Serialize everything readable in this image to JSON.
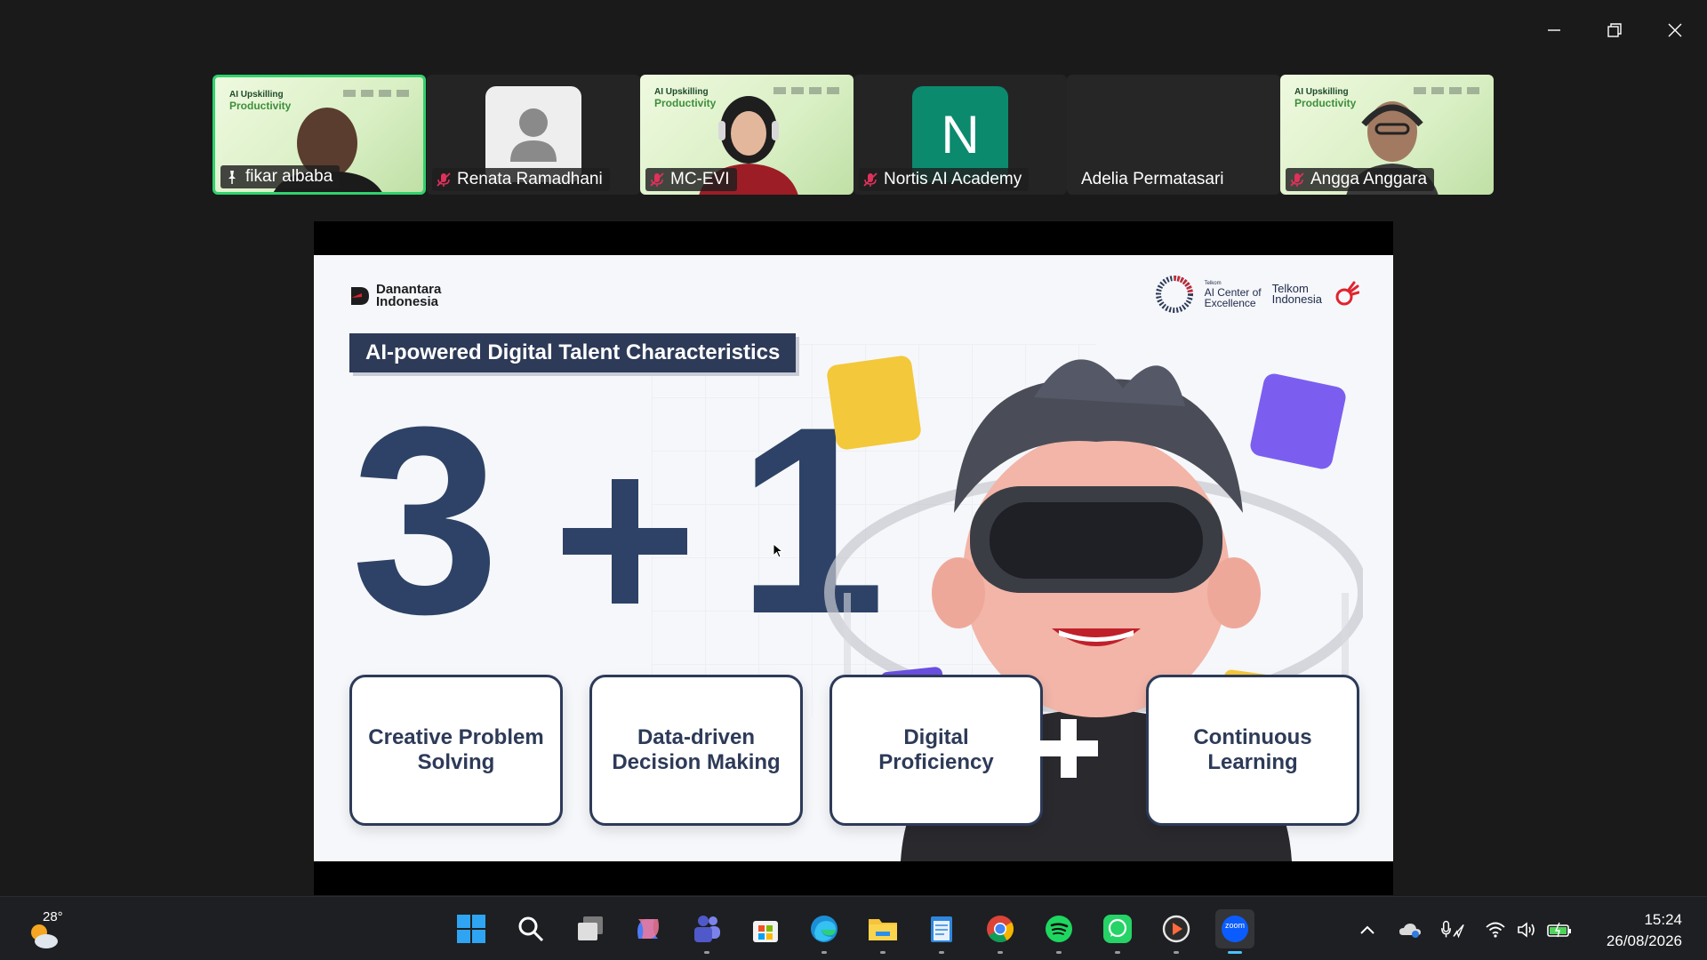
{
  "window": {
    "controls": [
      "minimize",
      "restore",
      "close"
    ]
  },
  "participants": [
    {
      "name": "fikar albaba",
      "muted": false,
      "pinned": true,
      "speaking": true,
      "type": "video"
    },
    {
      "name": "Renata Ramadhani",
      "muted": true,
      "type": "avatar-default"
    },
    {
      "name": "MC-EVI",
      "muted": true,
      "type": "video"
    },
    {
      "name": "Nortis AI Academy",
      "muted": true,
      "type": "avatar-letter",
      "initial": "N",
      "avatar_color": "#0b8a6e"
    },
    {
      "name": "Adelia Permatasari",
      "muted": false,
      "type": "blank"
    },
    {
      "name": "Angga Anggara",
      "muted": true,
      "type": "video"
    }
  ],
  "mini_slide": {
    "line1": "AI Upskilling",
    "line2": "Productivity"
  },
  "slide": {
    "brand_left": {
      "line1": "Danantara",
      "line2": "Indonesia"
    },
    "brand_right": {
      "small": "Telkom",
      "coe_line1": "AI Center of",
      "coe_line2": "Excellence",
      "telkom_line1": "Telkom",
      "telkom_line2": "Indonesia"
    },
    "title": "AI-powered Digital Talent Characteristics",
    "hero": {
      "a": "3",
      "op": "+",
      "b": "1"
    },
    "cards": [
      "Creative Problem Solving",
      "Data-driven Decision Making",
      "Digital Proficiency",
      "Continuous Learning"
    ],
    "colors": {
      "navy": "#2d3a58",
      "hero": "#2d4266"
    }
  },
  "taskbar": {
    "weather_temp": "28°",
    "apps": [
      "start-icon",
      "search-icon",
      "task-view-icon",
      "copilot-icon",
      "teams-icon",
      "store-icon",
      "edge-icon",
      "file-explorer-icon",
      "notepad-icon",
      "chrome-icon",
      "spotify-icon",
      "whatsapp-icon",
      "media-player-icon",
      "zoom-icon"
    ],
    "zoom_label": "zoom",
    "time": "15:24",
    "date": "26/08/2026"
  }
}
